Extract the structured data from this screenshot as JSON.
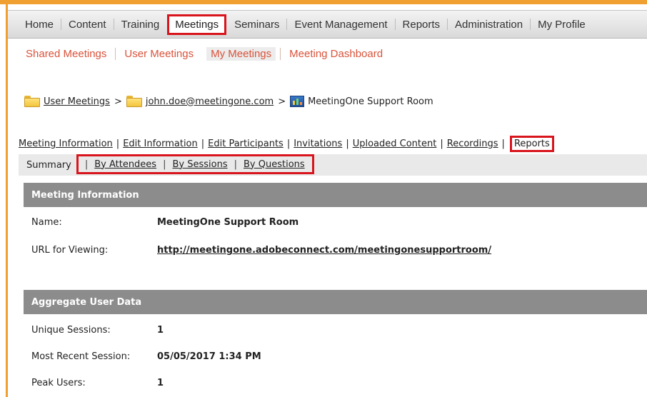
{
  "top_nav": {
    "items": [
      "Home",
      "Content",
      "Training",
      "Meetings",
      "Seminars",
      "Event Management",
      "Reports",
      "Administration",
      "My Profile"
    ],
    "active": "Meetings"
  },
  "sub_nav": {
    "items": [
      "Shared Meetings",
      "User Meetings",
      "My Meetings",
      "Meeting Dashboard"
    ],
    "current": "My Meetings"
  },
  "breadcrumb": {
    "level1": "User Meetings",
    "level2": "john.doe@meetingone.com",
    "level3": "MeetingOne Support Room",
    "separator": ">"
  },
  "meeting_tabs": {
    "items": [
      "Meeting Information",
      "Edit Information",
      "Edit Participants",
      "Invitations",
      "Uploaded Content",
      "Recordings",
      "Reports"
    ],
    "active": "Reports"
  },
  "report_tabs": {
    "summary": "Summary",
    "items": [
      "By Attendees",
      "By Sessions",
      "By Questions"
    ]
  },
  "meeting_information": {
    "header": "Meeting Information",
    "name_label": "Name:",
    "name_value": "MeetingOne Support Room",
    "url_label": "URL for Viewing:",
    "url_value": "http://meetingone.adobeconnect.com/meetingonesupportroom/"
  },
  "aggregate_user_data": {
    "header": "Aggregate User Data",
    "unique_sessions_label": "Unique Sessions:",
    "unique_sessions_value": "1",
    "recent_session_label": "Most Recent Session:",
    "recent_session_value": "05/05/2017 1:34 PM",
    "peak_users_label": "Peak Users:",
    "peak_users_value": "1"
  },
  "colors": {
    "frame_orange": "#f0a030",
    "highlight_red": "#d8141c",
    "subnav_link": "#d9533b",
    "section_header_bg": "#8c8c8c"
  }
}
